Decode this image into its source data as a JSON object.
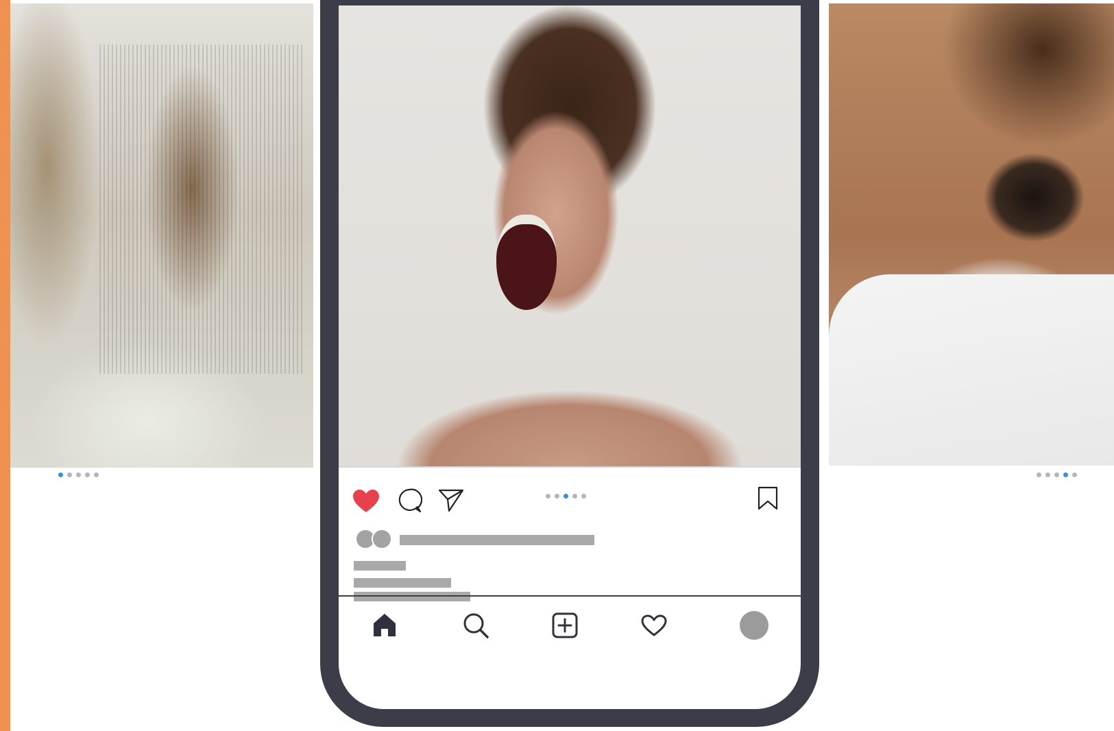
{
  "colors": {
    "accent": "#ef9151",
    "phone_frame": "#3b3e49",
    "like_red": "#e8414e",
    "active_dot": "#3c8fd9",
    "placeholder_gray": "#a9a9a9"
  },
  "left_card": {
    "image": "hand-behind-fabric-photo",
    "carousel": {
      "count": 5,
      "active_index": 0
    }
  },
  "post": {
    "image": "woman-screaming-photo",
    "liked": true,
    "carousel": {
      "count": 5,
      "active_index": 2
    },
    "actions": [
      "heart-icon",
      "comment-icon",
      "share-icon",
      "bookmark-icon"
    ]
  },
  "right_card": {
    "image": "eye-close-up-photo",
    "carousel": {
      "count": 5,
      "active_index": 3
    }
  },
  "bottom_nav": {
    "items": [
      "home-icon",
      "search-icon",
      "add-post-icon",
      "activity-heart-icon",
      "profile-avatar"
    ],
    "active": "home-icon"
  }
}
